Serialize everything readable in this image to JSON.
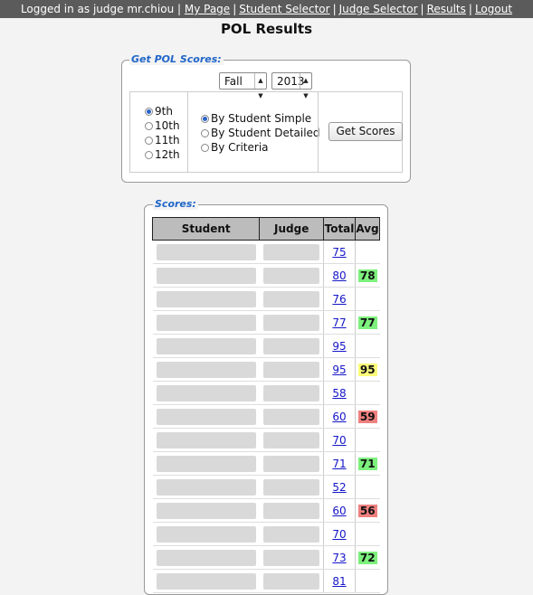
{
  "topbar": {
    "logged_in_text": "Logged in as judge mr.chiou |",
    "links": [
      "My Page",
      "Student Selector",
      "Judge Selector",
      "Results",
      "Logout"
    ]
  },
  "page_title": "POL Results",
  "get_scores": {
    "legend": "Get POL Scores:",
    "season": "Fall",
    "year": "2013",
    "grades": [
      {
        "label": "9th",
        "checked": true
      },
      {
        "label": "10th",
        "checked": false
      },
      {
        "label": "11th",
        "checked": false
      },
      {
        "label": "12th",
        "checked": false
      }
    ],
    "modes": [
      {
        "label": "By Student Simple",
        "checked": true
      },
      {
        "label": "By Student Detailed",
        "checked": false
      },
      {
        "label": "By Criteria",
        "checked": false
      }
    ],
    "button_label": "Get Scores"
  },
  "scores": {
    "legend": "Scores:",
    "columns": [
      "Student",
      "Judge",
      "Total",
      "Avg"
    ],
    "groups": [
      {
        "totals": [
          "75",
          "80"
        ],
        "avg": "78",
        "avg_color": "#7df07d"
      },
      {
        "totals": [
          "76",
          "77"
        ],
        "avg": "77",
        "avg_color": "#7df07d"
      },
      {
        "totals": [
          "95",
          "95"
        ],
        "avg": "95",
        "avg_color": "#fbfb7a"
      },
      {
        "totals": [
          "58",
          "60"
        ],
        "avg": "59",
        "avg_color": "#f08080"
      },
      {
        "totals": [
          "70",
          "71"
        ],
        "avg": "71",
        "avg_color": "#7df07d"
      },
      {
        "totals": [
          "52",
          "60"
        ],
        "avg": "56",
        "avg_color": "#f08080"
      },
      {
        "totals": [
          "70",
          "73"
        ],
        "avg": "72",
        "avg_color": "#7df07d"
      },
      {
        "totals": [
          "81"
        ],
        "avg": "",
        "avg_color": ""
      }
    ]
  }
}
